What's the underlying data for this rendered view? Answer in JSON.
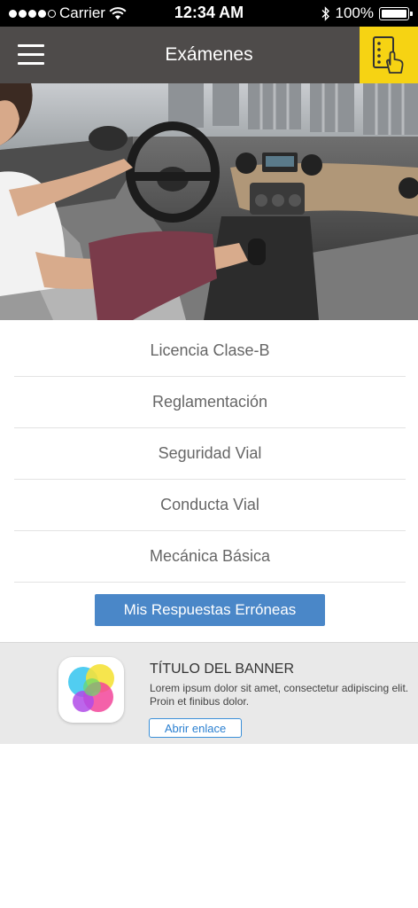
{
  "status_bar": {
    "carrier": "Carrier",
    "time": "12:34 AM",
    "battery": "100%"
  },
  "nav": {
    "title": "Exámenes",
    "menu_icon": "hamburger-menu-icon",
    "action_icon": "list-touch-icon",
    "action_color": "#f6d313",
    "bar_color": "#4e4b4a"
  },
  "hero": {
    "image": "woman-driving-car-interior"
  },
  "menu": {
    "items": [
      {
        "label": "Licencia Clase-B"
      },
      {
        "label": "Reglamentación"
      },
      {
        "label": "Seguridad Vial"
      },
      {
        "label": "Conducta Vial"
      },
      {
        "label": "Mecánica Básica"
      }
    ]
  },
  "wrong_answers_button": {
    "label": "Mis Respuestas Erróneas",
    "color": "#4a87c8"
  },
  "banner": {
    "title": "TÍTULO DEL BANNER",
    "text": "Lorem ipsum dolor sit amet, consectetur adipiscing elit. Proin et finibus dolor.",
    "link_label": "Abrir enlace",
    "icon": "game-center-bubbles-icon"
  }
}
